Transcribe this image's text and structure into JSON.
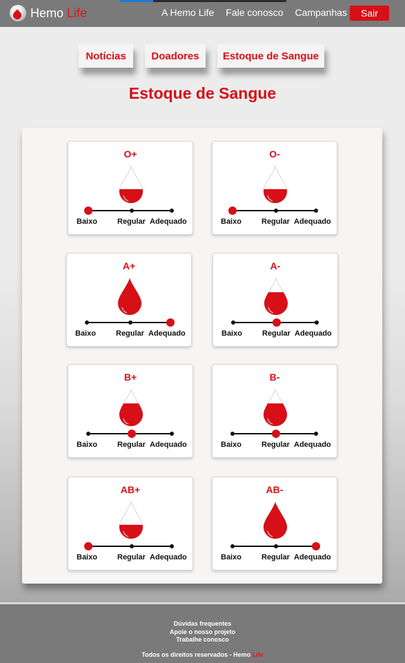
{
  "header": {
    "logo_main": "Hemo",
    "logo_accent": "Life",
    "nav": [
      "A Hemo Life",
      "Fale conosco",
      "Campanhas"
    ],
    "logout_label": "Sair",
    "page_load_progress": 0.2
  },
  "tabs": [
    "Notícias",
    "Doadores",
    "Estoque de Sangue"
  ],
  "page_title": "Estoque de Sangue",
  "levels": [
    "Baixo",
    "Regular",
    "Adequado"
  ],
  "stock": [
    {
      "type": "O+",
      "level": 0
    },
    {
      "type": "O-",
      "level": 0
    },
    {
      "type": "A+",
      "level": 2
    },
    {
      "type": "A-",
      "level": 1
    },
    {
      "type": "B+",
      "level": 1
    },
    {
      "type": "B-",
      "level": 1
    },
    {
      "type": "AB+",
      "level": 0
    },
    {
      "type": "AB-",
      "level": 2
    }
  ],
  "footer": {
    "links": [
      "Dúvidas frequentes",
      "Apoie o nosso projeto",
      "Trabalhe conosco"
    ],
    "copyright_prefix": "Todos os direitos reservados - Hemo ",
    "copyright_accent": "Life"
  },
  "colors": {
    "accent": "#d70f17",
    "header_bg": "#7a7a7a",
    "track": "#111111"
  }
}
